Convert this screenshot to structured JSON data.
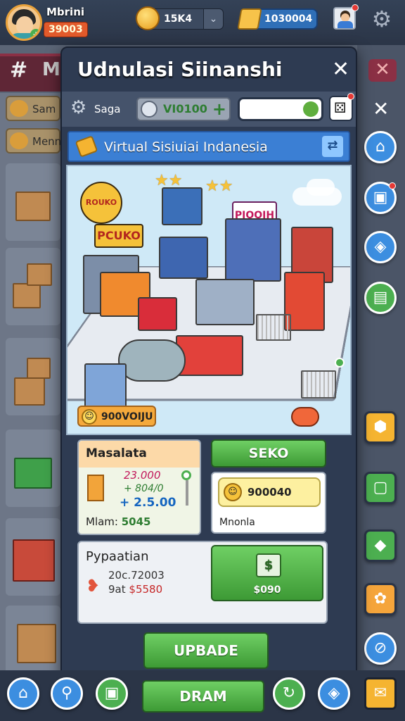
{
  "player": {
    "name": "Mbrini",
    "level": "39003"
  },
  "currency": {
    "coins": "15K4",
    "gems": "1030004"
  },
  "background": {
    "panel_letter": "M",
    "tab1": "Sam",
    "tab2": "Menn"
  },
  "modal": {
    "title": "Udnulasi Siinanshi",
    "save_label": "Saga",
    "cash_value": "VI0100",
    "banner_title": "Virtual Sisiuiai Indanesia",
    "scene": {
      "badge_value": "900VOIJU",
      "signs": [
        "ROUKO",
        "PCUKO",
        "PIOOIH"
      ]
    },
    "stats": {
      "header": "Masalata",
      "line1": "23.000",
      "line2": "+ 804/0",
      "line3": "+ 2.5.00",
      "footer_label": "Mlam:",
      "footer_value": "5045"
    },
    "seko_label": "SEKO",
    "deal": {
      "value": "900040",
      "label": "Mnonla"
    },
    "payment": {
      "title": "Pypaatian",
      "line1": "20c.72003",
      "line2_label": "9at",
      "line2_value": "$5580"
    },
    "cash_button_label": "$090",
    "upgrade_label": "UPBADE"
  },
  "bottom": {
    "main_label": "DRAM"
  },
  "colors": {
    "accent_green": "#4caf50",
    "modal_bg": "#2e3b52",
    "banner_blue": "#3b7fd4",
    "danger_red": "#e53935"
  },
  "icons": [
    "gear-icon",
    "close-icon",
    "coin-icon",
    "gem-icon",
    "dice-icon",
    "key-icon",
    "share-icon",
    "cart-icon",
    "cash-icon",
    "heart-icon",
    "home-icon",
    "box-icon",
    "compass-icon",
    "mail-icon"
  ]
}
